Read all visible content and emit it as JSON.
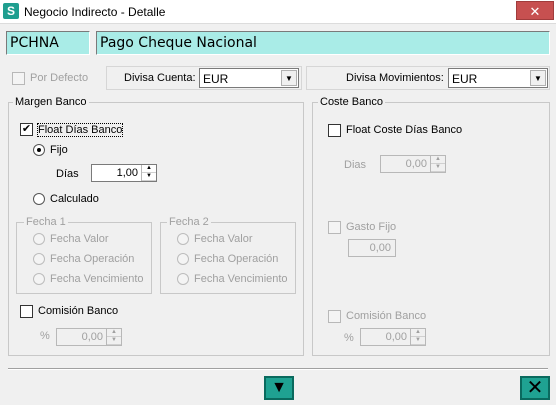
{
  "window": {
    "title": "Negocio Indirecto - Detalle",
    "close_symbol": "✕",
    "app_icon_glyph": "S"
  },
  "header": {
    "code": "PCHNA",
    "description": "Pago Cheque Nacional"
  },
  "defaults": {
    "por_defecto_label": "Por Defecto",
    "divisa_cuenta_label": "Divisa Cuenta:",
    "divisa_cuenta_value": "EUR",
    "divisa_movimientos_label": "Divisa Movimientos:",
    "divisa_movimientos_value": "EUR"
  },
  "margen": {
    "title": "Margen Banco",
    "float_label": "Float Días Banco",
    "float_checked": true,
    "fijo_label": "Fijo",
    "dias_label": "Días",
    "dias_value": "1,00",
    "calculado_label": "Calculado",
    "fecha1": {
      "title": "Fecha 1",
      "opts": [
        "Fecha Valor",
        "Fecha Operación",
        "Fecha Vencimiento"
      ]
    },
    "fecha2": {
      "title": "Fecha 2",
      "opts": [
        "Fecha Valor",
        "Fecha Operación",
        "Fecha Vencimiento"
      ]
    },
    "comision_label": "Comisión Banco",
    "pct_label": "%",
    "pct_value": "0,00"
  },
  "coste": {
    "title": "Coste Banco",
    "float_label": "Float Coste Días Banco",
    "dias_label": "Dias",
    "dias_value": "0,00",
    "gasto_label": "Gasto Fijo",
    "gasto_value": "0,00",
    "comision_label": "Comisión Banco",
    "pct_label": "%",
    "pct_value": "0,00"
  },
  "footer": {
    "down_symbol": "▼",
    "cancel_symbol": "✕"
  },
  "colors": {
    "header_bg": "#a9ece7",
    "button_bg": "#1fa292"
  }
}
